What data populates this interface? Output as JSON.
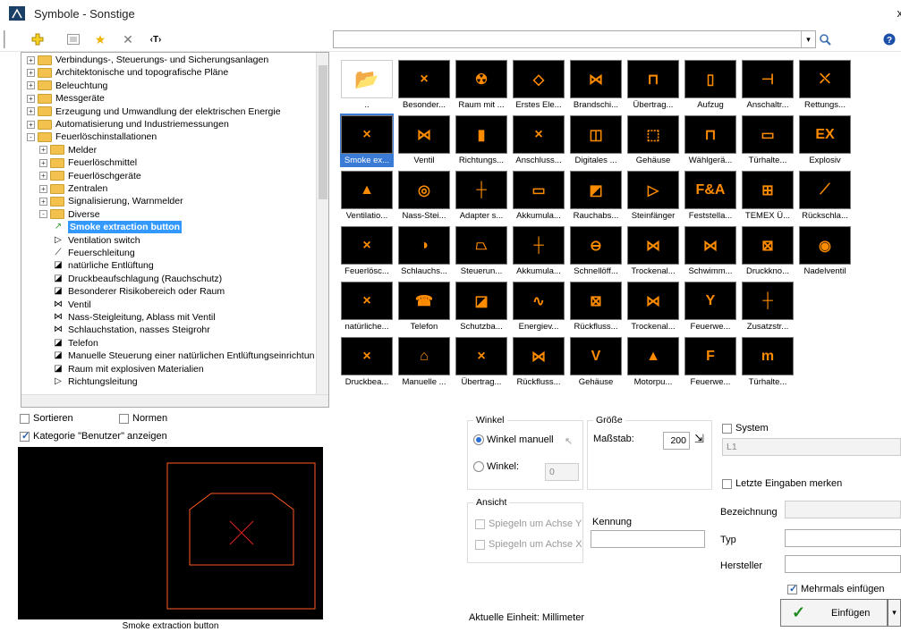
{
  "window": {
    "title": "Symbole - Sonstige",
    "close": "x"
  },
  "toolbar": {
    "search_value": ""
  },
  "tree": {
    "items": [
      {
        "label": "Verbindungs-, Steuerungs- und Sicherungsanlagen",
        "level": 0,
        "kind": "folder",
        "exp": "+"
      },
      {
        "label": "Architektonische und topografische Pläne",
        "level": 0,
        "kind": "folder",
        "exp": "+"
      },
      {
        "label": "Beleuchtung",
        "level": 0,
        "kind": "folder",
        "exp": "+"
      },
      {
        "label": "Messgeräte",
        "level": 0,
        "kind": "folder",
        "exp": "+"
      },
      {
        "label": "Erzeugung und Umwandlung der elektrischen Energie",
        "level": 0,
        "kind": "folder",
        "exp": "+"
      },
      {
        "label": "Automatisierung und Industriemessungen",
        "level": 0,
        "kind": "folder",
        "exp": "+"
      },
      {
        "label": "Feuerlöschinstallationen",
        "level": 0,
        "kind": "folder",
        "exp": "-"
      },
      {
        "label": "Melder",
        "level": 1,
        "kind": "folder",
        "exp": "+"
      },
      {
        "label": "Feuerlöschmittel",
        "level": 1,
        "kind": "folder",
        "exp": "+"
      },
      {
        "label": "Feuerlöschgeräte",
        "level": 1,
        "kind": "folder",
        "exp": "+"
      },
      {
        "label": "Zentralen",
        "level": 1,
        "kind": "folder",
        "exp": "+"
      },
      {
        "label": "Signalisierung, Warnmelder",
        "level": 1,
        "kind": "folder",
        "exp": "+"
      },
      {
        "label": "Diverse",
        "level": 1,
        "kind": "folder",
        "exp": "-"
      },
      {
        "label": "Smoke extraction button",
        "level": 2,
        "kind": "leaf",
        "icon": "↗",
        "selected": true
      },
      {
        "label": "Ventilation switch",
        "level": 2,
        "kind": "leaf",
        "icon": "▷"
      },
      {
        "label": "Feuerschleitung",
        "level": 2,
        "kind": "leaf",
        "icon": "⟋"
      },
      {
        "label": "natürliche Entlüftung",
        "level": 2,
        "kind": "leaf",
        "icon": "◪"
      },
      {
        "label": "Druckbeaufschlagung (Rauchschutz)",
        "level": 2,
        "kind": "leaf",
        "icon": "◪"
      },
      {
        "label": "Besonderer Risikobereich oder Raum",
        "level": 2,
        "kind": "leaf",
        "icon": "◪"
      },
      {
        "label": "Ventil",
        "level": 2,
        "kind": "leaf",
        "icon": "⋈"
      },
      {
        "label": "Nass-Steigleitung, Ablass mit Ventil",
        "level": 2,
        "kind": "leaf",
        "icon": "⋈"
      },
      {
        "label": "Schlauchstation, nasses Steigrohr",
        "level": 2,
        "kind": "leaf",
        "icon": "⋈"
      },
      {
        "label": "Telefon",
        "level": 2,
        "kind": "leaf",
        "icon": "◪"
      },
      {
        "label": "Manuelle Steuerung einer natürlichen Entlüftungseinrichtun",
        "level": 2,
        "kind": "leaf",
        "icon": "◪"
      },
      {
        "label": "Raum mit explosiven Materialien",
        "level": 2,
        "kind": "leaf",
        "icon": "◪"
      },
      {
        "label": "Richtungsleitung",
        "level": 2,
        "kind": "leaf",
        "icon": "▷"
      }
    ]
  },
  "grid": {
    "rows": [
      [
        {
          "label": "..",
          "glyph": "📂",
          "folder": true
        },
        {
          "label": "Besonder...",
          "glyph": "×"
        },
        {
          "label": "Raum mit ...",
          "glyph": "☢"
        },
        {
          "label": "Erstes Ele...",
          "glyph": "◇"
        },
        {
          "label": "Brandschi...",
          "glyph": "⋈"
        },
        {
          "label": "Übertrag...",
          "glyph": "⊓"
        },
        {
          "label": "Aufzug",
          "glyph": "▯"
        },
        {
          "label": "Anschaltr...",
          "glyph": "⊣"
        },
        {
          "label": "Rettungs...",
          "glyph": "⛌"
        }
      ],
      [
        {
          "label": "Smoke ex...",
          "glyph": "×",
          "selected": true
        },
        {
          "label": "Ventil",
          "glyph": "⋈"
        },
        {
          "label": "Richtungs...",
          "glyph": "▮"
        },
        {
          "label": "Anschluss...",
          "glyph": "×"
        },
        {
          "label": "Digitales ...",
          "glyph": "◫"
        },
        {
          "label": "Gehäuse",
          "glyph": "⬚"
        },
        {
          "label": "Wählgerä...",
          "glyph": "⊓"
        },
        {
          "label": "Türhalte...",
          "glyph": "▭"
        },
        {
          "label": "Explosiv",
          "glyph": "EX"
        }
      ],
      [
        {
          "label": "Ventilatio...",
          "glyph": "▲"
        },
        {
          "label": "Nass-Stei...",
          "glyph": "◎"
        },
        {
          "label": "Adapter s...",
          "glyph": "┼"
        },
        {
          "label": "Akkumula...",
          "glyph": "▭"
        },
        {
          "label": "Rauchabs...",
          "glyph": "◩"
        },
        {
          "label": "Steinfänger",
          "glyph": "▷"
        },
        {
          "label": "Feststella...",
          "glyph": "F&A"
        },
        {
          "label": "TEMEX Ü...",
          "glyph": "⊞"
        },
        {
          "label": "Rückschla...",
          "glyph": "⟋"
        }
      ],
      [
        {
          "label": "Feuerlösc...",
          "glyph": "×"
        },
        {
          "label": "Schlauchs...",
          "glyph": "◑"
        },
        {
          "label": "Steuerun...",
          "glyph": "⏢"
        },
        {
          "label": "Akkumula...",
          "glyph": "┼"
        },
        {
          "label": "Schnellöff...",
          "glyph": "⊖"
        },
        {
          "label": "Trockenal...",
          "glyph": "⋈"
        },
        {
          "label": "Schwimm...",
          "glyph": "⋈"
        },
        {
          "label": "Druckkno...",
          "glyph": "⊠"
        },
        {
          "label": "Nadelventil",
          "glyph": "◉"
        }
      ],
      [
        {
          "label": "natürliche...",
          "glyph": "×"
        },
        {
          "label": "Telefon",
          "glyph": "☎"
        },
        {
          "label": "Schutzba...",
          "glyph": "◪"
        },
        {
          "label": "Energiev...",
          "glyph": "∿"
        },
        {
          "label": "Rückfluss...",
          "glyph": "⊠"
        },
        {
          "label": "Trockenal...",
          "glyph": "⋈"
        },
        {
          "label": "Feuerwe...",
          "glyph": "Y"
        },
        {
          "label": "Zusatzstr...",
          "glyph": "┼"
        }
      ],
      [
        {
          "label": "Druckbea...",
          "glyph": "×"
        },
        {
          "label": "Manuelle ...",
          "glyph": "⌂"
        },
        {
          "label": "Übertrag...",
          "glyph": "×"
        },
        {
          "label": "Rückfluss...",
          "glyph": "⋈"
        },
        {
          "label": "Gehäuse",
          "glyph": "V"
        },
        {
          "label": "Motorpu...",
          "glyph": "▲"
        },
        {
          "label": "Feuerwe...",
          "glyph": "F"
        },
        {
          "label": "Türhalte...",
          "glyph": "m"
        }
      ]
    ]
  },
  "options": {
    "sort": "Sortieren",
    "norms": "Normen",
    "category": "Kategorie \"Benutzer\" anzeigen"
  },
  "preview": {
    "caption": "Smoke extraction button"
  },
  "winkel": {
    "title": "Winkel",
    "manual": "Winkel manuell",
    "angle": "Winkel:",
    "angle_value": "0"
  },
  "groesse": {
    "title": "Größe",
    "scale": "Maßstab:",
    "scale_value": "200"
  },
  "system": {
    "label": "System",
    "value": "L1",
    "remember": "Letzte Eingaben merken"
  },
  "ansicht": {
    "title": "Ansicht",
    "mirror_y": "Spiegeln um Achse Y",
    "mirror_x": "Spiegeln um Achse X"
  },
  "kennung": {
    "label": "Kennung",
    "value": ""
  },
  "fields": {
    "bezeichnung": "Bezeichnung",
    "typ": "Typ",
    "hersteller": "Hersteller"
  },
  "footer": {
    "unit": "Aktuelle Einheit: Millimeter",
    "multi": "Mehrmals einfügen",
    "insert": "Einfügen"
  }
}
